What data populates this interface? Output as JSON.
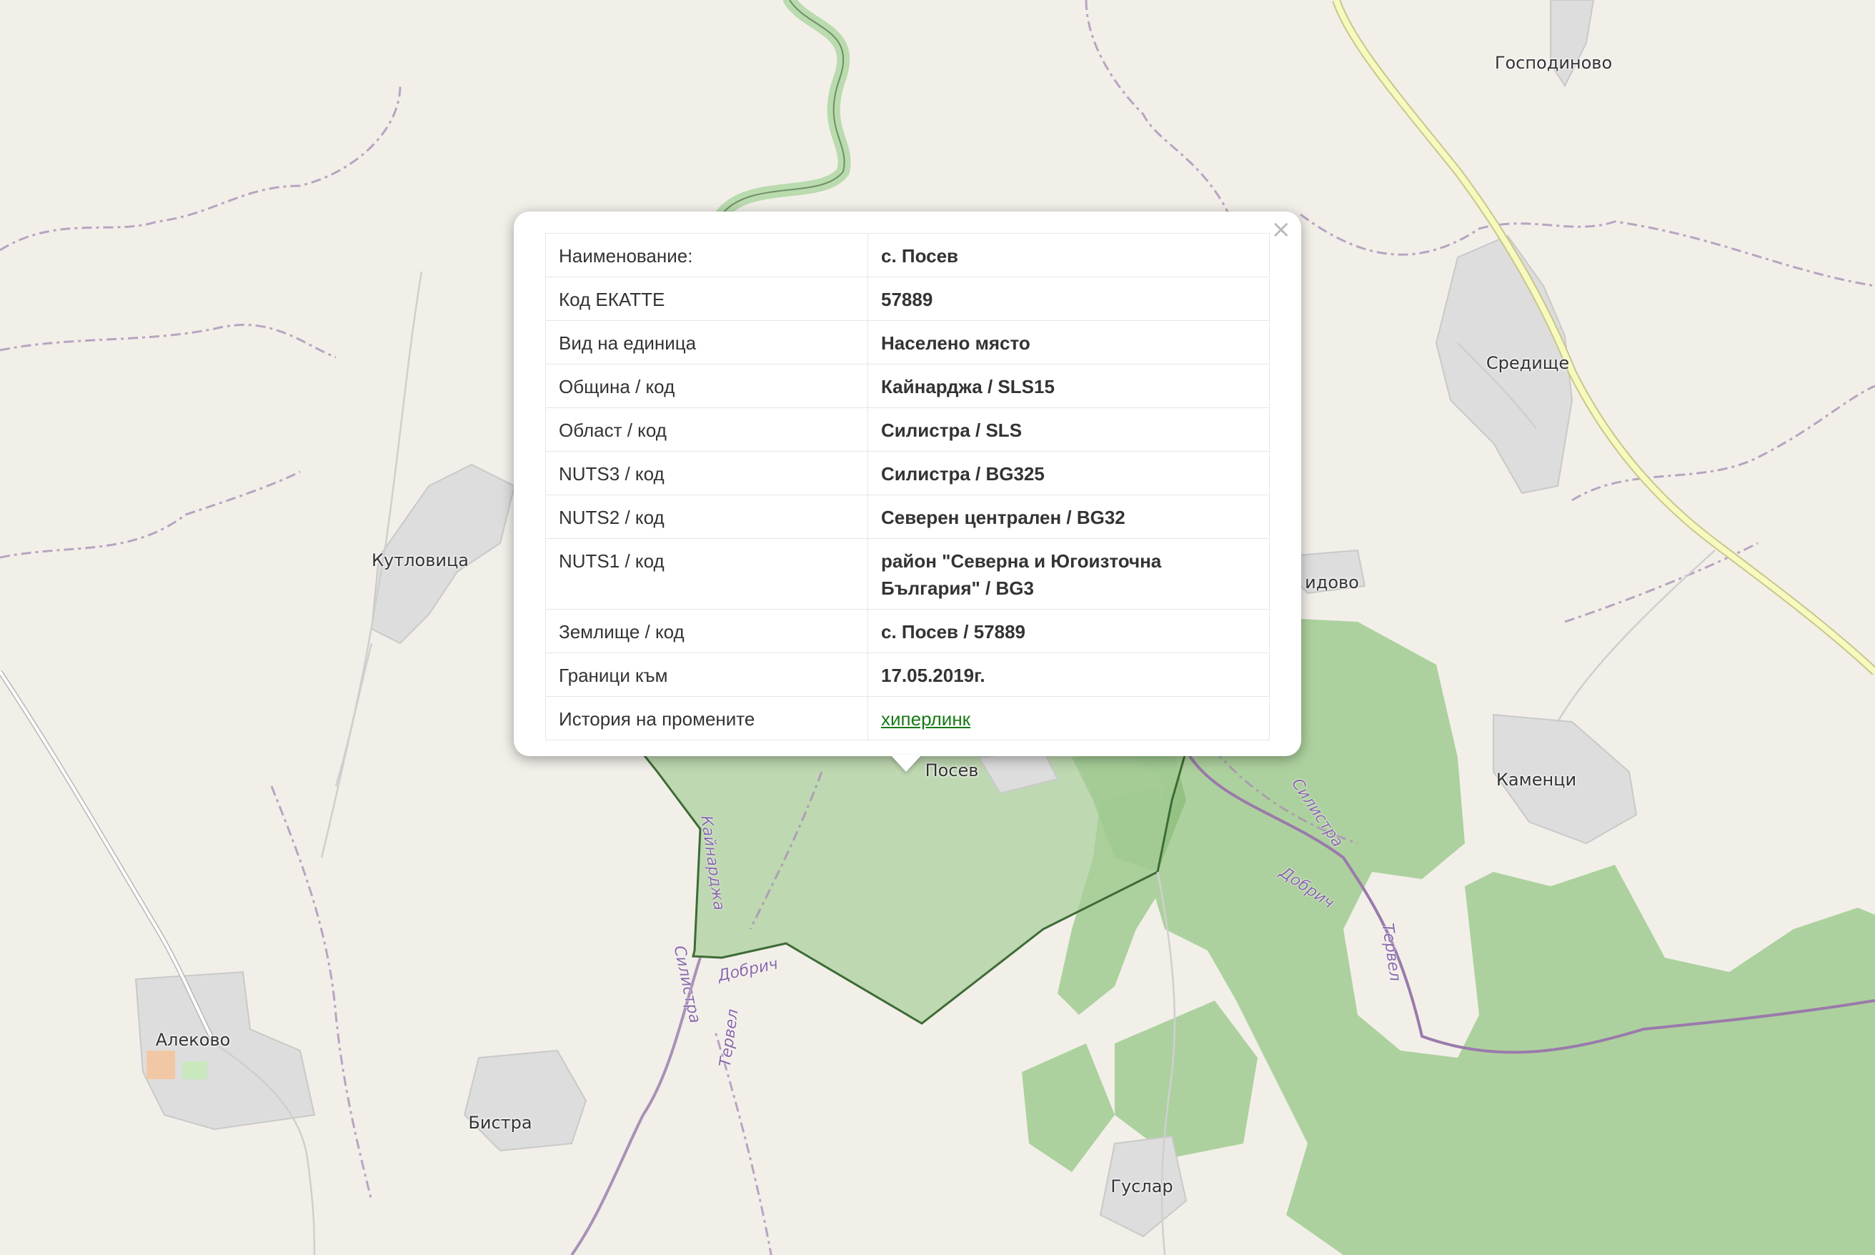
{
  "popup": {
    "close_symbol": "×",
    "rows": [
      {
        "label": "Наименование:",
        "value": "с. Посев"
      },
      {
        "label": "Код ЕКАТТЕ",
        "value": "57889"
      },
      {
        "label": "Вид на единица",
        "value": "Населено място"
      },
      {
        "label": "Община / код",
        "value": "Кайнарджа / SLS15"
      },
      {
        "label": "Област / код",
        "value": "Силистра / SLS"
      },
      {
        "label": "NUTS3 / код",
        "value": "Силистра / BG325"
      },
      {
        "label": "NUTS2 / код",
        "value": "Северен централен / BG32"
      },
      {
        "label": "NUTS1 / код",
        "value": "район \"Северна и Югоизточна България\" / BG3"
      },
      {
        "label": "Землище / код",
        "value": "с. Посев / 57889"
      },
      {
        "label": "Граници към",
        "value": "17.05.2019г."
      },
      {
        "label": "История на промените",
        "link": "хиперлинк"
      }
    ]
  },
  "map": {
    "places": {
      "gospodinovo": "Господиново",
      "sreditse": "Средище",
      "kutlovitsa": "Кутловица",
      "idovo_partial": "идово",
      "kamentsi": "Каменци",
      "posev": "Посев",
      "alekovo": "Алеково",
      "bistra": "Бистра",
      "guslar": "Гуслар"
    },
    "boundary_labels": {
      "kaynardzha": "Кайнарджа",
      "silistra_left": "Силистра",
      "dobrich_left": "Добрич",
      "tervel_left": "Тервел",
      "silistra_right": "Силистра",
      "dobrich_right": "Добрич",
      "tervel_right": "Тервел"
    },
    "colors": {
      "background": "#f2efe9",
      "forest": "#add19e",
      "highlight_fill": "#a8cf98",
      "highlight_stroke": "#3d6b35",
      "village": "#dddddd",
      "admin_border": "#a991b5",
      "main_road": "#f7fabf",
      "link": "#177a17"
    }
  }
}
